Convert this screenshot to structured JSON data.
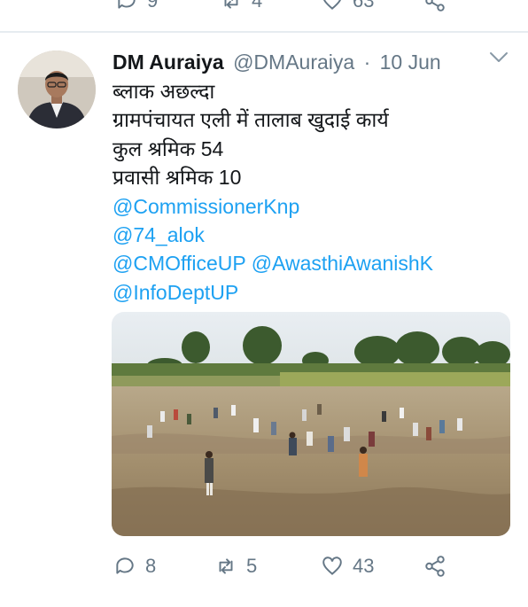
{
  "previous_tweet": {
    "reply_count": "9",
    "retweet_count": "4",
    "like_count": "63"
  },
  "tweet": {
    "author_name": "DM Auraiya",
    "author_handle": "@DMAuraiya",
    "separator": "·",
    "date": "10 Jun",
    "lines": [
      "ब्लाक अछल्दा",
      "ग्रामपंचायत एली में तालाब खुदाई कार्य",
      "कुल श्रमिक 54",
      "प्रवासी श्रमिक 10"
    ],
    "mentions": [
      "@CommissionerKnp",
      "@74_alok",
      "@CMOfficeUP @AwasthiAwanishK",
      "@InfoDeptUP"
    ],
    "reply_count": "8",
    "retweet_count": "5",
    "like_count": "43"
  },
  "colors": {
    "link": "#1da1f2",
    "muted": "#657786",
    "divider": "#e6ecf0"
  },
  "icons": [
    "reply-icon",
    "retweet-icon",
    "like-icon",
    "share-icon",
    "chevron-down-icon"
  ]
}
